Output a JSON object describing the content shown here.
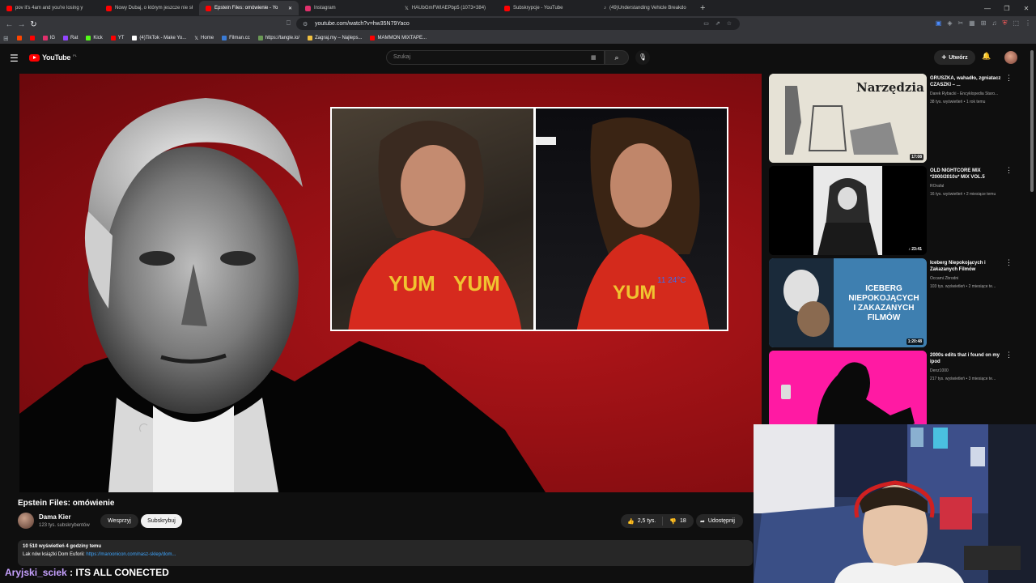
{
  "browser": {
    "tabs": [
      {
        "label": "pov it's 4am and you're losing y",
        "color": "#ff0000",
        "active": false
      },
      {
        "label": "Nowy Dubaj, o którym jeszcze nie sł",
        "color": "#ff0000",
        "active": false
      },
      {
        "label": "Epstein Files: omówienie - Yo",
        "color": "#ff0000",
        "active": true
      },
      {
        "label": "Instagram",
        "color": "#e1306c",
        "active": false
      },
      {
        "label": "HAUbGmFWIAEPbp5 (1073×384)",
        "color": "#ffffff",
        "active": false
      },
      {
        "label": "Subskrypcje - YouTube",
        "color": "#ff0000",
        "active": false
      },
      {
        "label": "(49)Understanding Vehicle Breakdo",
        "color": "#ffffff",
        "active": false
      }
    ],
    "url": "youtube.com/watch?v=hw35N79Yaco",
    "bookmarks": [
      {
        "label": "",
        "color": "#ff4500"
      },
      {
        "label": "",
        "color": "#ff0000"
      },
      {
        "label": "IG",
        "color": "#e1306c"
      },
      {
        "label": "Rat",
        "color": "#9146ff"
      },
      {
        "label": "Kick",
        "color": "#53fc18"
      },
      {
        "label": "YT",
        "color": "#ff0000"
      },
      {
        "label": "(4)TikTok - Make Yo...",
        "color": "#ffffff"
      },
      {
        "label": "Home",
        "color": "#ffffff"
      },
      {
        "label": "Filman.cc",
        "color": "#3a7bd5"
      },
      {
        "label": "https://tangle.io/",
        "color": "#6a9955"
      },
      {
        "label": "Zagraj.my – Najleps...",
        "color": "#f0c040"
      },
      {
        "label": "MAMMON MIXTAPE...",
        "color": "#ff0000"
      }
    ]
  },
  "youtube": {
    "logo_text": "YouTube",
    "logo_region": "PL",
    "search_placeholder": "Szukaj",
    "create_label": "Utwórz",
    "video": {
      "title": "Epstein Files: omówienie",
      "channel": "Dama Kier",
      "subscribers": "123 tys. subskrybentów",
      "support_label": "Wesprzyj",
      "subscribe_label": "Subskrybuj",
      "likes": "2,5 tys.",
      "dislikes": "18",
      "share_label": "Udostępnij",
      "views_date": "10 510 wyświetleń  4 godziny temu",
      "desc_prefix": "Lak",
      "desc_text": "nów książki Dom Euforii:",
      "desc_link": "https://maroonicon.com/nasz-sklep/dom..."
    },
    "recommendations": [
      {
        "title": "GRUSZKA, wahadło, zgniatacz CZASZKI – ...",
        "channel": "Darek Rybacki - Encyklopedia Staro...",
        "meta": "38 tys. wyświetleń • 1 rok temu",
        "duration": "17:08",
        "thumb_text": "Narzędzia tortur"
      },
      {
        "title": "OLD NIGHTCORE MIX *2000/2010s* MIX VOL.5",
        "channel": "ROrafal",
        "meta": "16 tys. wyświetleń • 2 miesiące temu",
        "duration": "♪ 23:41",
        "thumb_text": ""
      },
      {
        "title": "Iceberg Niepokojących i Zakazanych Filmów",
        "channel": "Occami Zbrodni",
        "meta": "103 tys. wyświetleń • 2 miesiące te...",
        "duration": "1:20:48",
        "thumb_text": "ICEBERG NIEPOKOJĄCYCH I ZAKAZANYCH FILMÓW"
      },
      {
        "title": "2000s edits that i found on my ipod",
        "channel": "Denz1000",
        "meta": "217 tys. wyświetleń • 3 miesiące te...",
        "duration": "",
        "thumb_text": ""
      }
    ]
  },
  "chat": {
    "username": "Aryjski_sciek",
    "message": " : ITS ALL CONECTED"
  }
}
